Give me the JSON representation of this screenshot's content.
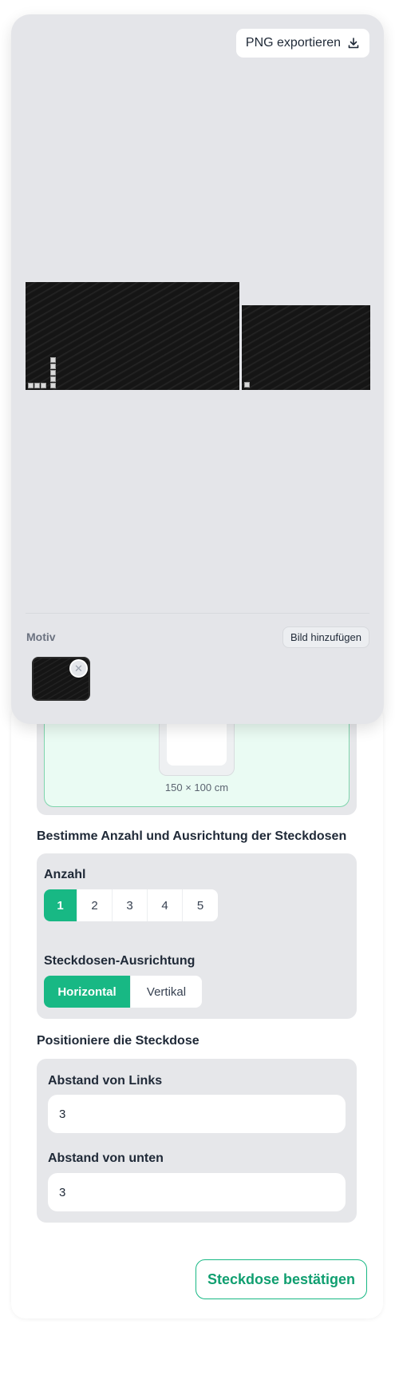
{
  "export": {
    "label": "PNG exportieren",
    "icon": "download-icon"
  },
  "motiv": {
    "label": "Motiv",
    "add_image_label": "Bild hinzufügen",
    "remove_icon": "close-icon"
  },
  "preview": {
    "dimensions": "150 × 100 cm"
  },
  "count_section": {
    "title": "Bestimme Anzahl und Ausrichtung der Steckdosen",
    "count_label": "Anzahl",
    "counts": [
      "1",
      "2",
      "3",
      "4",
      "5"
    ],
    "selected_count": "1",
    "orientation_label": "Steckdosen-Ausrichtung",
    "orientations": [
      "Horizontal",
      "Vertikal"
    ],
    "selected_orientation": "Horizontal"
  },
  "position_section": {
    "title": "Positioniere die Steckdose",
    "left_label": "Abstand von Links",
    "left_value": "3",
    "bottom_label": "Abstand von unten",
    "bottom_value": "3"
  },
  "confirm_label": "Steckdose bestätigen",
  "colors": {
    "accent": "#18b884",
    "panel": "#e4e5e9",
    "card": "#e6e7ea"
  }
}
